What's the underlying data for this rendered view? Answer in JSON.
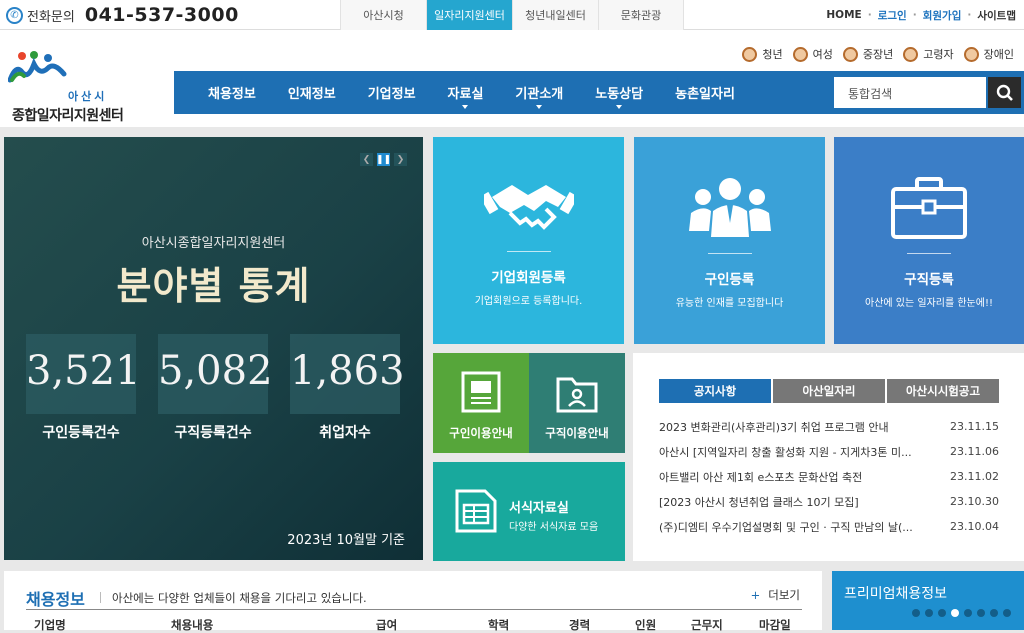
{
  "topbar": {
    "phone_label": "전화문의",
    "phone_number": "041-537-3000",
    "tabs": [
      {
        "label": "아산시청"
      },
      {
        "label": "일자리지원센터"
      },
      {
        "label": "청년내일센터"
      },
      {
        "label": "문화관광"
      }
    ],
    "links": {
      "home": "HOME",
      "login": "로그인",
      "signup": "회원가입",
      "sitemap": "사이트맵"
    }
  },
  "logo": {
    "city": "아산시",
    "name": "종합일자리지원센터"
  },
  "personas": [
    {
      "label": "청년"
    },
    {
      "label": "여성"
    },
    {
      "label": "중장년"
    },
    {
      "label": "고령자"
    },
    {
      "label": "장애인"
    }
  ],
  "nav": {
    "items": [
      {
        "label": "채용정보"
      },
      {
        "label": "인재정보"
      },
      {
        "label": "기업정보"
      },
      {
        "label": "자료실"
      },
      {
        "label": "기관소개"
      },
      {
        "label": "노동상담"
      },
      {
        "label": "농촌일자리"
      }
    ],
    "search_placeholder": "통합검색"
  },
  "slide": {
    "subtitle": "아산시종합일자리지원센터",
    "title": "분야별 통계",
    "stats": [
      {
        "value": "3,521",
        "label": "구인등록건수"
      },
      {
        "value": "5,082",
        "label": "구직등록건수"
      },
      {
        "value": "1,863",
        "label": "취업자수"
      }
    ],
    "footnote": "2023년 10월말 기준"
  },
  "tiles": {
    "company": {
      "title": "기업회원등록",
      "desc": "기업회원으로 등록합니다."
    },
    "hire": {
      "title": "구인등록",
      "desc": "유능한 인재를 모집합니다"
    },
    "job": {
      "title": "구직등록",
      "desc": "아산에 있는 일자리를 한눈에!!"
    },
    "hire_guide": {
      "title": "구인이용안내"
    },
    "job_guide": {
      "title": "구직이용안내"
    },
    "forms": {
      "title": "서식자료실",
      "desc": "다양한 서식자료 모음"
    }
  },
  "notice": {
    "tabs": [
      {
        "label": "공지사항"
      },
      {
        "label": "아산일자리"
      },
      {
        "label": "아산시시험공고"
      }
    ],
    "items": [
      {
        "title": "2023 변화관리(사후관리)3기 취업 프로그램 안내",
        "date": "23.11.15"
      },
      {
        "title": "아산시 [지역일자리 창출 활성화 지원 - 지게차3톤 미...",
        "date": "23.11.06"
      },
      {
        "title": "아트밸리 아산 제1회 e스포츠 문화산업 축전",
        "date": "23.11.02"
      },
      {
        "title": "[2023 아산시 청년취업 클래스 10기 모집]",
        "date": "23.10.30"
      },
      {
        "title": "(주)디엠티 우수기업설명회 및 구인 · 구직 만남의 날(...",
        "date": "23.10.04"
      }
    ]
  },
  "jobs": {
    "title": "채용정보",
    "desc": "아산에는 다양한 업체들이 채용을 기다리고 있습니다.",
    "more": "더보기",
    "columns": [
      "기업명",
      "채용내용",
      "급여",
      "학력",
      "경력",
      "인원",
      "근무지",
      "마감일"
    ]
  },
  "premium": {
    "title": "프리미엄채용정보",
    "active_dot": 3,
    "dot_count": 8
  }
}
